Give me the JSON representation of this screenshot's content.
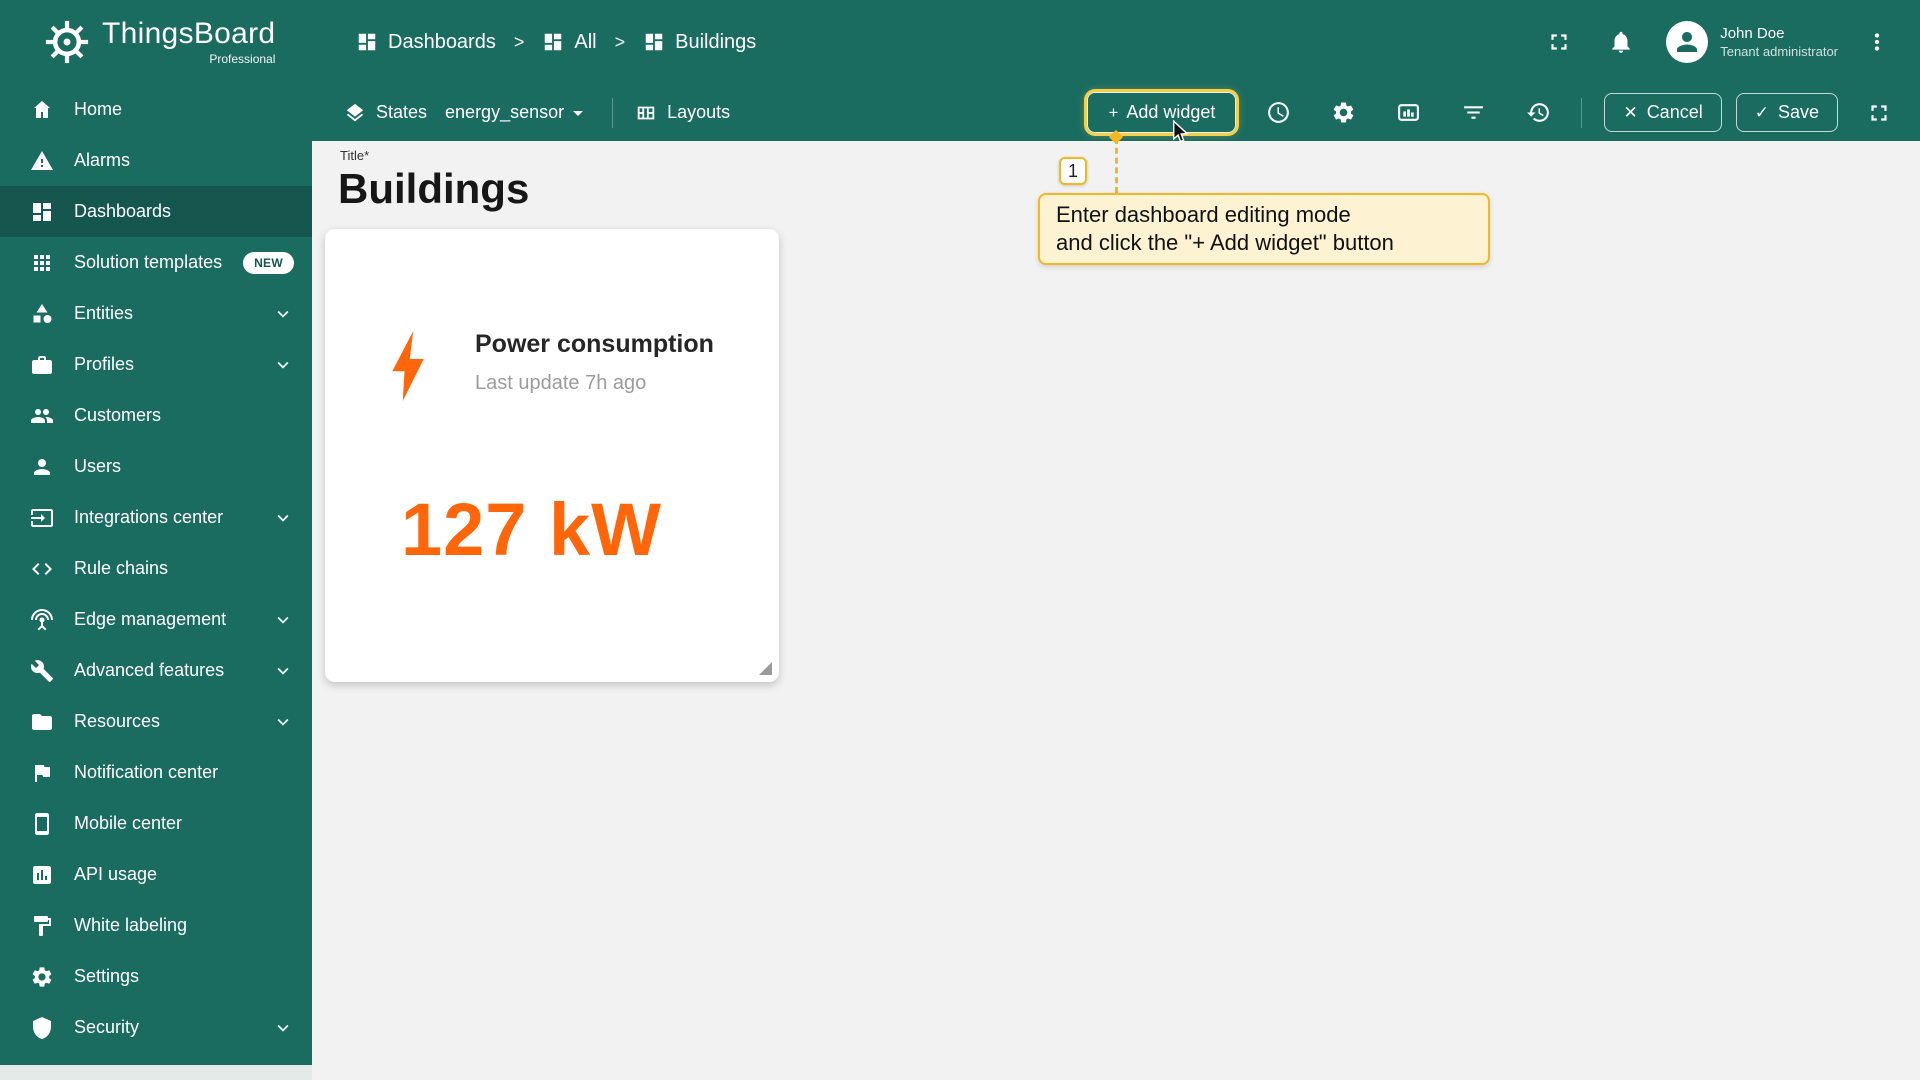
{
  "brand": {
    "name": "ThingsBoard",
    "subtitle": "Professional"
  },
  "header": {
    "separator": ">",
    "breadcrumbs": [
      {
        "label": "Dashboards"
      },
      {
        "label": "All"
      },
      {
        "label": "Buildings"
      }
    ],
    "user": {
      "name": "John Doe",
      "role": "Tenant administrator"
    }
  },
  "sidebar": {
    "items": [
      {
        "id": "home",
        "label": "Home",
        "icon": "home"
      },
      {
        "id": "alarms",
        "label": "Alarms",
        "icon": "warning"
      },
      {
        "id": "dashboards",
        "label": "Dashboards",
        "icon": "dashboard",
        "active": true
      },
      {
        "id": "solution-templates",
        "label": "Solution templates",
        "icon": "apps",
        "badge": "NEW"
      },
      {
        "id": "entities",
        "label": "Entities",
        "icon": "category",
        "chevron": true
      },
      {
        "id": "profiles",
        "label": "Profiles",
        "icon": "briefcase",
        "chevron": true
      },
      {
        "id": "customers",
        "label": "Customers",
        "icon": "people"
      },
      {
        "id": "users",
        "label": "Users",
        "icon": "person"
      },
      {
        "id": "integrations-center",
        "label": "Integrations center",
        "icon": "integration",
        "chevron": true
      },
      {
        "id": "rule-chains",
        "label": "Rule chains",
        "icon": "code"
      },
      {
        "id": "edge-management",
        "label": "Edge management",
        "icon": "antenna",
        "chevron": true
      },
      {
        "id": "advanced-features",
        "label": "Advanced features",
        "icon": "wrench",
        "chevron": true
      },
      {
        "id": "resources",
        "label": "Resources",
        "icon": "folder",
        "chevron": true
      },
      {
        "id": "notification-center",
        "label": "Notification center",
        "icon": "flag"
      },
      {
        "id": "mobile-center",
        "label": "Mobile center",
        "icon": "phone"
      },
      {
        "id": "api-usage",
        "label": "API usage",
        "icon": "chart"
      },
      {
        "id": "white-labeling",
        "label": "White labeling",
        "icon": "paint"
      },
      {
        "id": "settings",
        "label": "Settings",
        "icon": "gear"
      },
      {
        "id": "security",
        "label": "Security",
        "icon": "shield",
        "chevron": true
      }
    ]
  },
  "toolbar": {
    "states_label": "States",
    "state_value": "energy_sensor",
    "layouts_label": "Layouts",
    "plus": "+",
    "add_widget_label": "Add widget",
    "cancel_icon": "✕",
    "cancel_label": "Cancel",
    "save_icon": "✓",
    "save_label": "Save"
  },
  "main": {
    "title_label": "Title*",
    "title": "Buildings",
    "widget": {
      "title": "Power consumption",
      "subtitle": "Last update 7h ago",
      "value": "127 kW"
    },
    "annotation": {
      "step": "1",
      "line1": "Enter dashboard editing mode",
      "line2": "and click the \"+ Add widget\" button"
    }
  },
  "colors": {
    "brand_teal": "#1a6b60",
    "accent_orange": "#ff660a",
    "highlight_yellow": "#f2b824",
    "tooltip_bg": "#fdf3d3"
  }
}
